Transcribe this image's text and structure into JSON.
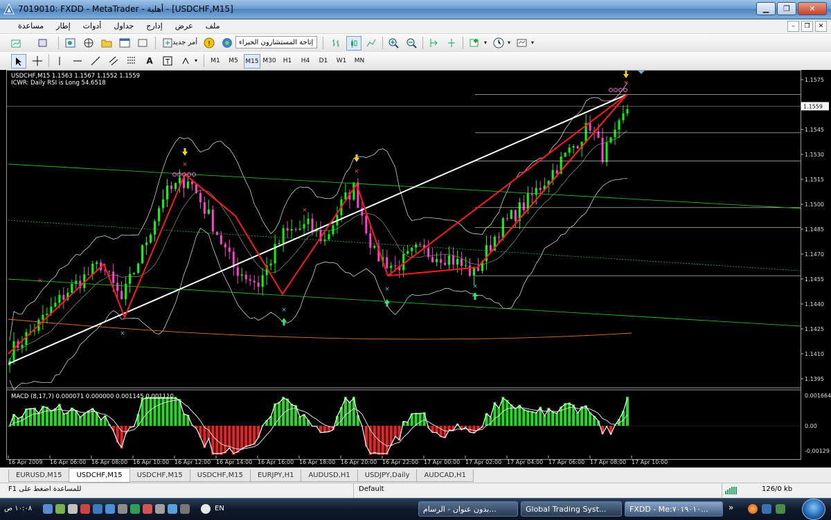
{
  "window": {
    "title": "7019010: FXDD - MetaTrader - أهلية - [USDCHF,M15]"
  },
  "menu": [
    "ملف",
    "عرض",
    "إدارج",
    "جداول",
    "أدوات",
    "إطار",
    "مساعدة"
  ],
  "toolbar": {
    "new_order": "أمر جديد",
    "profile_label": "إتاحة المستشارون الخبراء"
  },
  "timeframes": [
    "M1",
    "M5",
    "M15",
    "M30",
    "H1",
    "H4",
    "D1",
    "W1",
    "MN"
  ],
  "selected_timeframe": "M15",
  "chart": {
    "header_line1": "USDCHF,M15  1.1563 1.1567 1.1552 1.1559",
    "header_line2": "ICWR: Daily RSI is Long 54.6518",
    "price_labels": [
      "1.1575",
      "1.1560",
      "1.1545",
      "1.1530",
      "1.1515",
      "1.1500",
      "1.1485",
      "1.1470",
      "1.1455",
      "1.1440",
      "1.1425",
      "1.1410",
      "1.1395"
    ],
    "current_price": "1.1559",
    "macd_header": "MACD  (8,17,7)  0.000071  0.000000  0.001145  0.001110",
    "macd_labels": [
      "0.001664",
      "0.00",
      "-0.00129"
    ],
    "time_labels": [
      "16 Apr 2009",
      "16 Apr 06:00",
      "16 Apr 08:00",
      "16 Apr 10:00",
      "16 Apr 12:00",
      "16 Apr 14:00",
      "16 Apr 16:00",
      "16 Apr 18:00",
      "16 Apr 20:00",
      "16 Apr 22:00",
      "17 Apr 00:00",
      "17 Apr 02:00",
      "17 Apr 04:00",
      "17 Apr 06:00",
      "17 Apr 08:00",
      "17 Apr 10:00"
    ]
  },
  "chart_tabs": [
    "EURUSD,M15",
    "USDCHF,M15",
    "USDCHF,M15",
    "USDCHF,M15",
    "EURJPY,H1",
    "AUDUSD,H1",
    "USDJPY,Daily",
    "AUDCAD,H1"
  ],
  "active_tab_index": 1,
  "status": {
    "help": "F1 للمساعدة اضغط على",
    "profile": "Default",
    "traffic": "126/0 kb"
  },
  "taskbar": {
    "clock": "١٠:٠٨ ص",
    "lang": "EN",
    "buttons": [
      "بدون عنوان - الرسام...",
      "Global Trading Syst...",
      "FXDD - Me:٧٠١٩٠١٠..."
    ]
  },
  "colors": {
    "bull": "#00ff00",
    "bear": "#ff3fcf",
    "zigzag": "#ff1a1a",
    "trendline": "#ffffff",
    "channel": "#1fbf1f"
  }
}
